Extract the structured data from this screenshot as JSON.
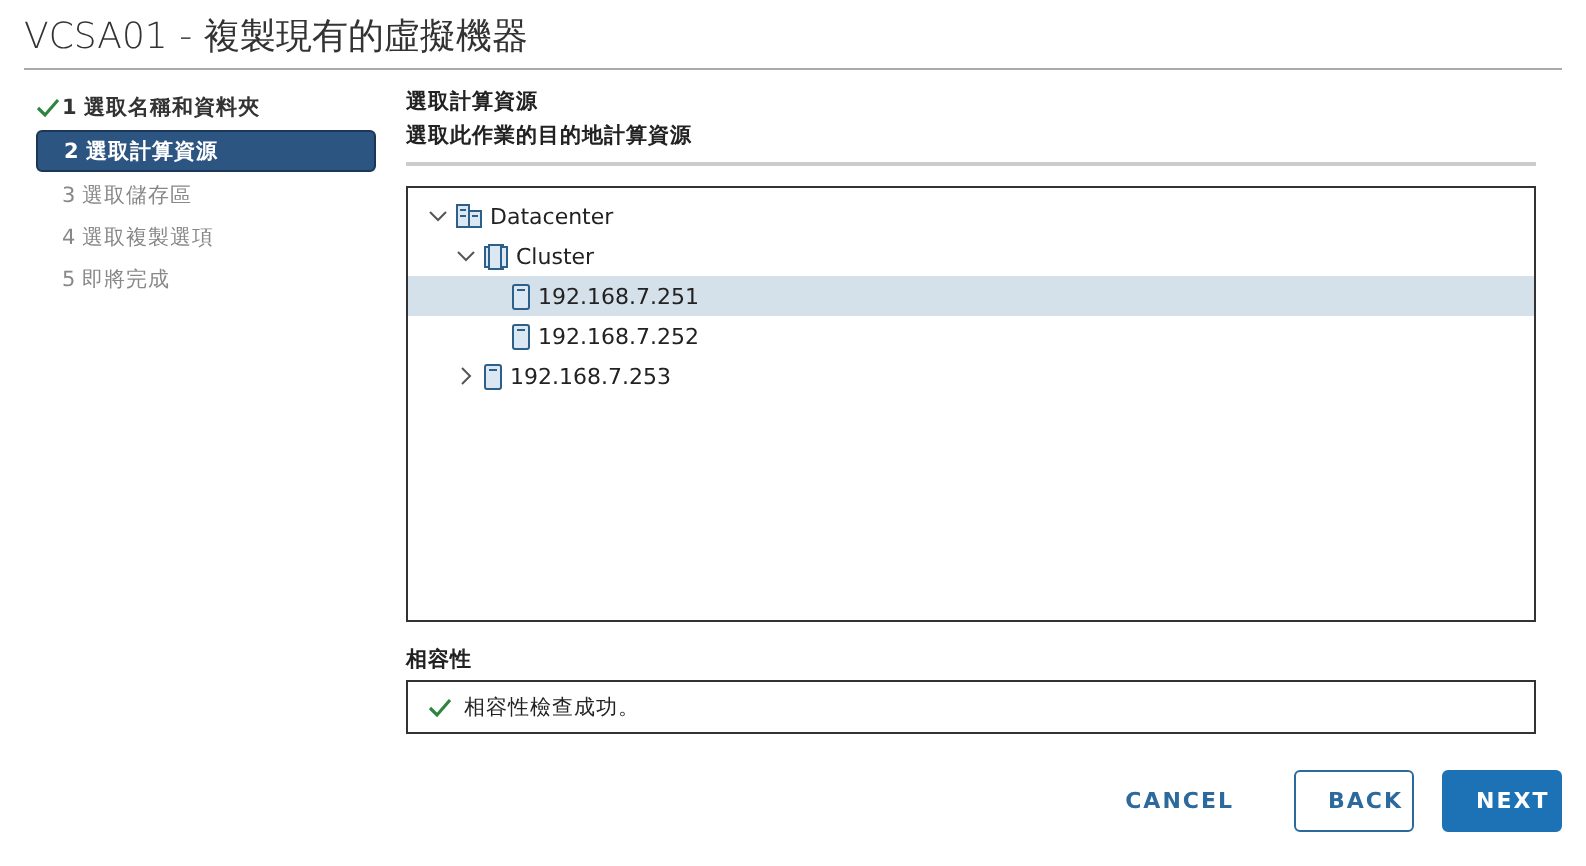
{
  "window": {
    "title": "VCSA01 - 複製現有的虛擬機器"
  },
  "steps": [
    {
      "label": "1 選取名稱和資料夾",
      "done": true,
      "selected": false,
      "disabled": false
    },
    {
      "label": "2 選取計算資源",
      "done": false,
      "selected": true,
      "disabled": false
    },
    {
      "label": "3 選取儲存區",
      "done": false,
      "selected": false,
      "disabled": true
    },
    {
      "label": "4 選取複製選項",
      "done": false,
      "selected": false,
      "disabled": true
    },
    {
      "label": "5 即將完成",
      "done": false,
      "selected": false,
      "disabled": true
    }
  ],
  "page": {
    "heading": "選取計算資源",
    "subheading": "選取此作業的目的地計算資源"
  },
  "tree": [
    {
      "label": "Datacenter",
      "kind": "datacenter",
      "expanded": true,
      "selected": false,
      "children": [
        {
          "label": "Cluster",
          "kind": "cluster",
          "expanded": true,
          "selected": false,
          "children": [
            {
              "label": "192.168.7.251",
              "kind": "host",
              "selected": true
            },
            {
              "label": "192.168.7.252",
              "kind": "host",
              "selected": false
            }
          ]
        },
        {
          "label": "192.168.7.253",
          "kind": "host",
          "expanded": false,
          "selected": false
        }
      ]
    }
  ],
  "compatibility": {
    "label": "相容性",
    "message": "相容性檢查成功。",
    "ok": true
  },
  "buttons": [
    {
      "label": "CANCEL",
      "kind": "link"
    },
    {
      "label": "BACK",
      "kind": "outline"
    },
    {
      "label": "NEXT",
      "kind": "primary"
    }
  ]
}
